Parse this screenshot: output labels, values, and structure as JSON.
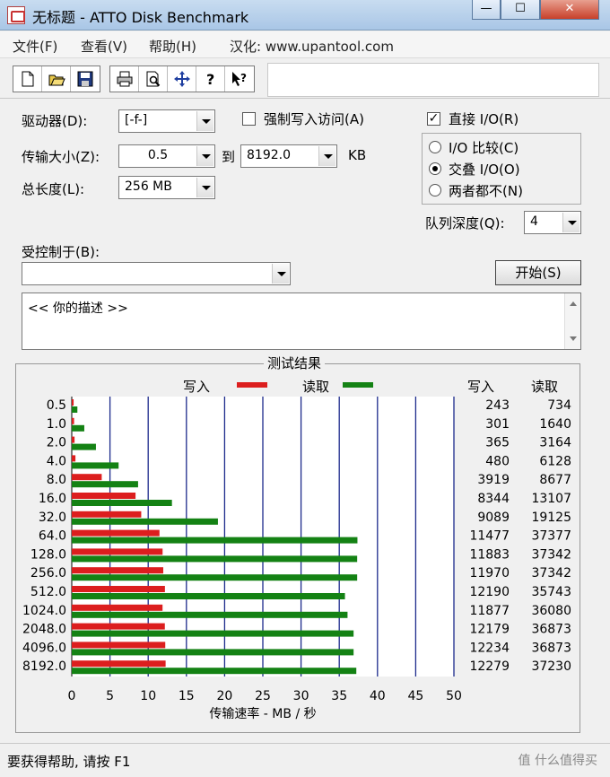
{
  "window": {
    "title": "无标题 - ATTO Disk Benchmark",
    "minimize": "—",
    "maximize": "☐",
    "close": "✕"
  },
  "menu": {
    "file": "文件(F)",
    "view": "查看(V)",
    "help": "帮助(H)",
    "credit": "汉化: www.upantool.com"
  },
  "toolbar": {
    "icons": [
      "new-icon",
      "open-icon",
      "save-icon",
      "print-icon",
      "preview-icon",
      "move-icon",
      "help-icon",
      "context-help-icon"
    ]
  },
  "settings": {
    "drive_label": "驱动器(D):",
    "drive_value": "[-f-]",
    "force_write_label": "强制写入访问(A)",
    "force_write_checked": false,
    "direct_io_label": "直接 I/O(R)",
    "direct_io_checked": true,
    "transfer_label": "传输大小(Z):",
    "transfer_from": "0.5",
    "to_label": "到",
    "transfer_to": "8192.0",
    "kb_label": "KB",
    "length_label": "总长度(L):",
    "length_value": "256 MB",
    "io_compare_label": "I/O 比较(C)",
    "overlapped_label": "交叠 I/O(O)",
    "neither_label": "两者都不(N)",
    "selected_mode": "overlapped",
    "queue_label": "队列深度(Q):",
    "queue_value": "4",
    "controlled_label": "受控制于(B):",
    "controlled_value": "",
    "start_button": "开始(S)",
    "description": "<<  你的描述  >>"
  },
  "results": {
    "title": "测试结果",
    "legend_write": "写入",
    "legend_read": "读取",
    "col_write": "写入",
    "col_read": "读取",
    "xlabel": "传输速率 - MB / 秒"
  },
  "chart_data": {
    "type": "bar",
    "orientation": "horizontal",
    "title": "测试结果",
    "xlabel": "传输速率 - MB / 秒",
    "xlim": [
      0,
      50
    ],
    "xticks": [
      "0",
      "5",
      "10",
      "15",
      "20",
      "25",
      "30",
      "35",
      "40",
      "45",
      "50"
    ],
    "categories": [
      "0.5",
      "1.0",
      "2.0",
      "4.0",
      "8.0",
      "16.0",
      "32.0",
      "64.0",
      "128.0",
      "256.0",
      "512.0",
      "1024.0",
      "2048.0",
      "4096.0",
      "8192.0"
    ],
    "series": [
      {
        "name": "写入",
        "color": "#dc1e1e",
        "values": [
          0.243,
          0.301,
          0.365,
          0.48,
          3.919,
          8.344,
          9.089,
          11.477,
          11.883,
          11.97,
          12.19,
          11.877,
          12.179,
          12.234,
          12.279
        ]
      },
      {
        "name": "读取",
        "color": "#148214",
        "values": [
          0.734,
          1.64,
          3.164,
          6.128,
          8.677,
          13.107,
          19.125,
          37.377,
          37.342,
          37.342,
          35.743,
          36.08,
          36.873,
          36.873,
          37.23
        ]
      }
    ],
    "write_labels": [
      "243",
      "301",
      "365",
      "480",
      "3919",
      "8344",
      "9089",
      "11477",
      "11883",
      "11970",
      "12190",
      "11877",
      "12179",
      "12234",
      "12279"
    ],
    "read_labels": [
      "734",
      "1640",
      "3164",
      "6128",
      "8677",
      "13107",
      "19125",
      "37377",
      "37342",
      "37342",
      "35743",
      "36080",
      "36873",
      "36873",
      "37230"
    ],
    "grid": true,
    "legend_position": "top"
  },
  "status": {
    "text": "要获得帮助, 请按 F1",
    "watermark": "值 什么值得买"
  }
}
